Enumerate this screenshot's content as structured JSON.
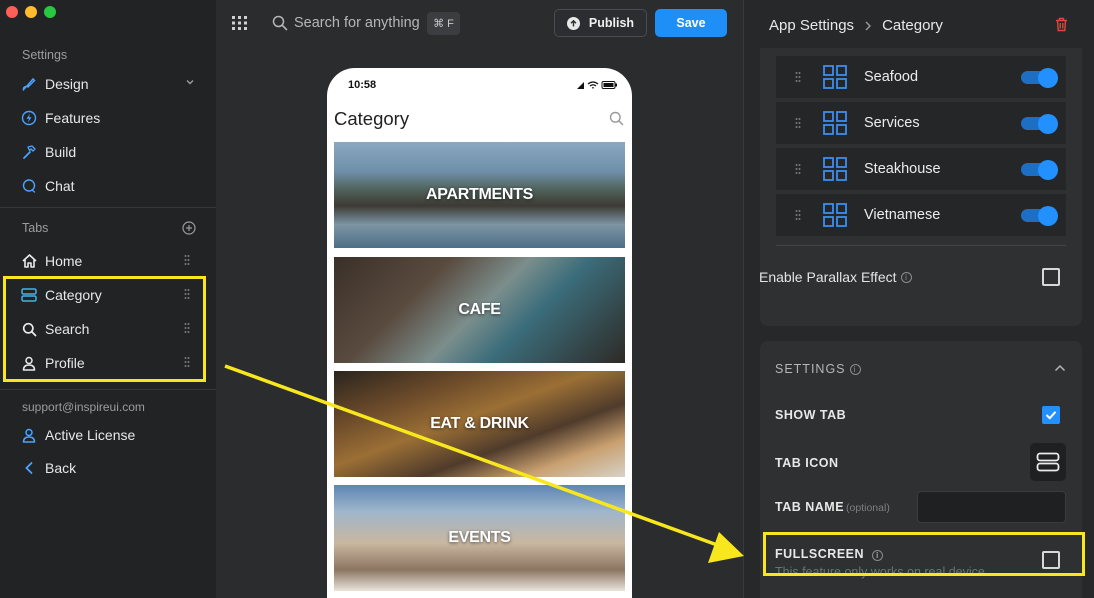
{
  "sidebar": {
    "settings_label": "Settings",
    "settings_items": [
      {
        "label": "Design",
        "icon": "brush-icon"
      },
      {
        "label": "Features",
        "icon": "lightning-icon"
      },
      {
        "label": "Build",
        "icon": "hammer-icon"
      },
      {
        "label": "Chat",
        "icon": "chat-icon"
      }
    ],
    "tabs_label": "Tabs",
    "tab_items": [
      {
        "label": "Home",
        "icon": "home-icon"
      },
      {
        "label": "Category",
        "icon": "category-icon"
      },
      {
        "label": "Search",
        "icon": "search-icon"
      },
      {
        "label": "Profile",
        "icon": "user-icon"
      }
    ],
    "account_email": "support@inspireui.com",
    "license_label": "Active License",
    "back_label": "Back"
  },
  "toolbar": {
    "search_placeholder": "Search for anything",
    "shortcut": "⌘ F",
    "publish_label": "Publish",
    "save_label": "Save"
  },
  "phone": {
    "time": "10:58",
    "title": "Category",
    "categories": [
      "APARTMENTS",
      "CAFE",
      "EAT & DRINK",
      "EVENTS"
    ]
  },
  "panel": {
    "breadcrumb_root": "App Settings",
    "breadcrumb_current": "Category",
    "category_rows": [
      {
        "name": "Seafood",
        "enabled": true
      },
      {
        "name": "Services",
        "enabled": true
      },
      {
        "name": "Steakhouse",
        "enabled": true
      },
      {
        "name": "Vietnamese",
        "enabled": true
      }
    ],
    "parallax_label": "Enable Parallax Effect",
    "parallax_checked": false,
    "settings_header": "SETTINGS",
    "show_tab_label": "SHOW TAB",
    "show_tab_checked": true,
    "tab_icon_label": "TAB ICON",
    "tab_name_label": "TAB NAME",
    "tab_name_optional": "(optional)",
    "tab_name_value": "",
    "fullscreen_label": "FULLSCREEN",
    "fullscreen_checked": false,
    "fullscreen_note": "This feature only works on real device"
  },
  "colors": {
    "accent": "#1e8ff6",
    "highlight": "#f8e71c",
    "delete": "#e0463c"
  }
}
